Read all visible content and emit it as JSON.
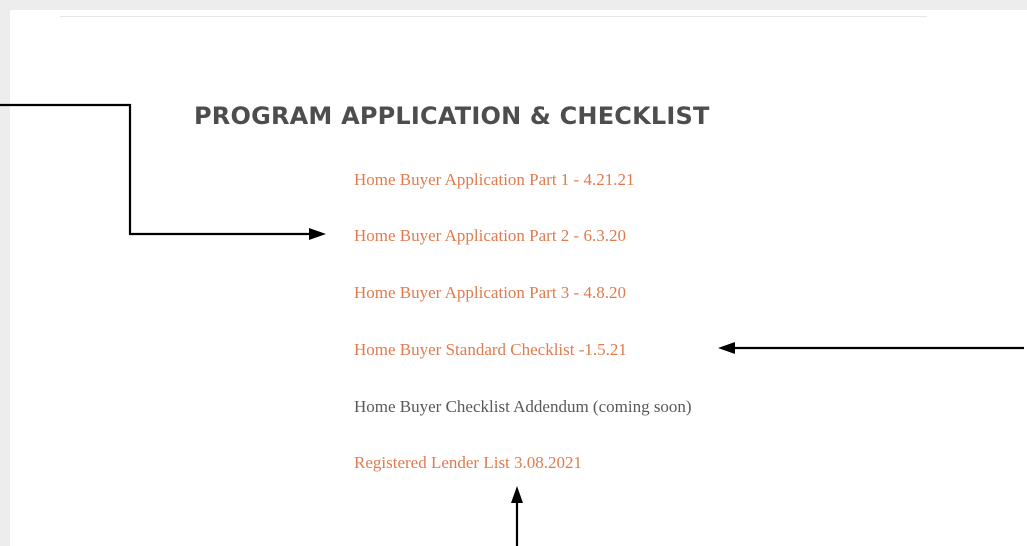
{
  "section": {
    "title": "PROGRAM APPLICATION & CHECKLIST"
  },
  "documents": [
    {
      "label": "Home Buyer Application Part 1 - 4.21.21",
      "link": true
    },
    {
      "label": "Home Buyer Application Part 2 - 6.3.20",
      "link": true
    },
    {
      "label": "Home Buyer Application Part 3 - 4.8.20",
      "link": true
    },
    {
      "label": "Home Buyer Standard Checklist -1.5.21",
      "link": true
    },
    {
      "label": "Home Buyer Checklist Addendum (coming soon)",
      "link": false
    },
    {
      "label": "Registered Lender List 3.08.2021",
      "link": true
    }
  ],
  "colors": {
    "link": "#e07b4f",
    "plain_text": "#595959",
    "heading": "#4d4d4d",
    "arrow": "#000000",
    "page_background": "#ffffff",
    "outer_background": "#ededed"
  }
}
